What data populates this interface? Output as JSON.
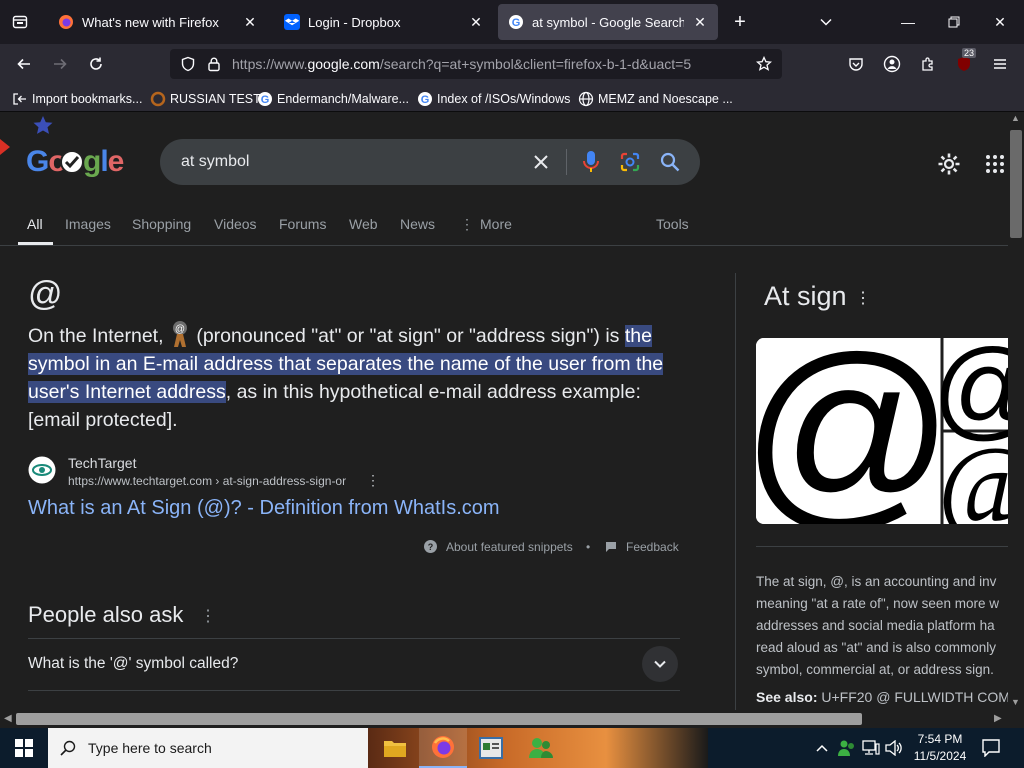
{
  "browser": {
    "tabs": [
      {
        "label": "What's new with Firefox",
        "active": false
      },
      {
        "label": "Login - Dropbox",
        "active": false
      },
      {
        "label": "at symbol - Google Search",
        "active": true
      }
    ],
    "url_prefix": "https://www.",
    "url_domain": "google.com",
    "url_rest": "/search?q=at+symbol&client=firefox-b-1-d&uact=5",
    "extension_badge": "23",
    "bookmarks": [
      "Import bookmarks...",
      "RUSSIAN TEST",
      "Endermanch/Malware...",
      "Index of /ISOs/Windows",
      "MEMZ and Noescape ..."
    ]
  },
  "search": {
    "logo": "Google",
    "query": "at symbol",
    "tabs": [
      "All",
      "Images",
      "Shopping",
      "Videos",
      "Forums",
      "Web",
      "News",
      "More"
    ],
    "tools_label": "Tools"
  },
  "snippet": {
    "heading": "@",
    "text_before": "On the Internet, ",
    "text_mid": " (pronounced \"at\" or \"at sign\" or \"address sign\") is ",
    "highlight": "the symbol in an E-mail address that separates the name of the user from the user's Internet address",
    "text_after": ", as in this hypothetical e-mail address example: [email protected].",
    "source_name": "TechTarget",
    "source_url": "https://www.techtarget.com › at-sign-address-sign-or",
    "link_title": "What is an At Sign (@)? - Definition from WhatIs.com",
    "about_label": "About featured snippets",
    "bullet": "•",
    "feedback_label": "Feedback"
  },
  "people_also_ask": {
    "title": "People also ask",
    "questions": [
      "What is the '@' symbol called?"
    ]
  },
  "knowledge_panel": {
    "title": "At sign",
    "description_lines": [
      "The at sign, @, is an accounting and inv",
      "meaning \"at a rate of\", now seen more w",
      "addresses and social media platform ha",
      "read aloud as \"at\" and is also commonly",
      "symbol, commercial at, or address sign."
    ],
    "see_also_label": "See also:",
    "see_also_value": "U+FF20 @ FULLWIDTH COM"
  },
  "taskbar": {
    "search_placeholder": "Type here to search",
    "time": "7:54 PM",
    "date": "11/5/2024"
  },
  "colors": {
    "link": "#8ab4f8",
    "highlight": "#394a80",
    "page_bg": "#1f1f1f",
    "chrome_bg": "#2b2a33"
  }
}
